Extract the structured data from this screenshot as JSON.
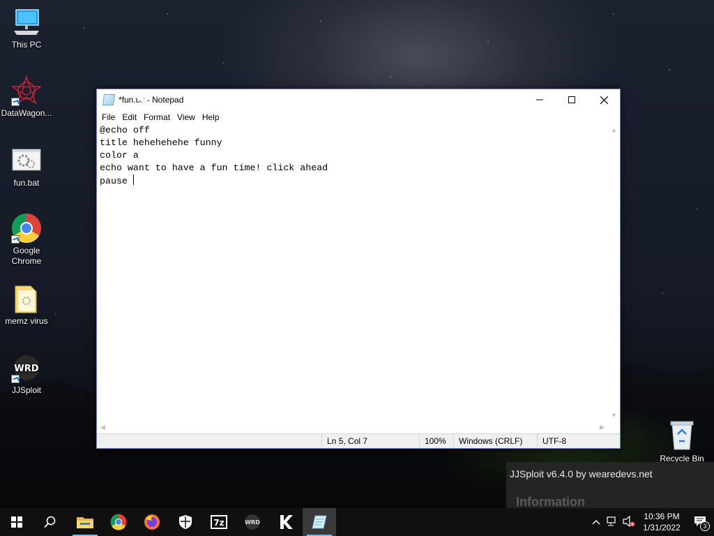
{
  "desktop": {
    "icons": [
      {
        "label": "This PC",
        "icon": "monitor-icon"
      },
      {
        "label": "DataWagon...",
        "icon": "red-star-icon"
      },
      {
        "label": "fun.bat",
        "icon": "batch-gears-icon"
      },
      {
        "label": "Google Chrome",
        "icon": "chrome-icon"
      },
      {
        "label": "memz virus",
        "icon": "folder-icon"
      },
      {
        "label": "JJSploit",
        "icon": "wrd-logo-icon"
      }
    ],
    "recycle_bin_label": "Recycle Bin"
  },
  "notepad": {
    "title": "*fun.txt - Notepad",
    "menu": [
      "File",
      "Edit",
      "Format",
      "View",
      "Help"
    ],
    "lines": [
      "@echo off",
      "title hehehehehe funny",
      "color a",
      "echo want to have a fun time! click ahead",
      "pause "
    ],
    "status": {
      "position": "Ln 5, Col 7",
      "zoom": "100%",
      "line_ending": "Windows (CRLF)",
      "encoding": "UTF-8"
    }
  },
  "notification": {
    "title": "JJSploit v6.4.0 by wearedevs.net",
    "body": "Information"
  },
  "taskbar": {
    "apps": [
      {
        "name": "start",
        "icon": "windows-icon"
      },
      {
        "name": "search",
        "icon": "search-icon"
      },
      {
        "name": "file-explorer",
        "icon": "folder-icon"
      },
      {
        "name": "chrome",
        "icon": "chrome-icon"
      },
      {
        "name": "firefox",
        "icon": "firefox-icon"
      },
      {
        "name": "security",
        "icon": "shield-icon"
      },
      {
        "name": "7zip",
        "icon": "7z-icon"
      },
      {
        "name": "jjsploit",
        "icon": "wrd-logo-icon"
      },
      {
        "name": "krnl",
        "icon": "k-icon"
      },
      {
        "name": "notepad",
        "icon": "notepad-icon"
      }
    ],
    "clock": {
      "time": "10:36 PM",
      "date": "1/31/2022"
    },
    "notification_count": "3"
  }
}
